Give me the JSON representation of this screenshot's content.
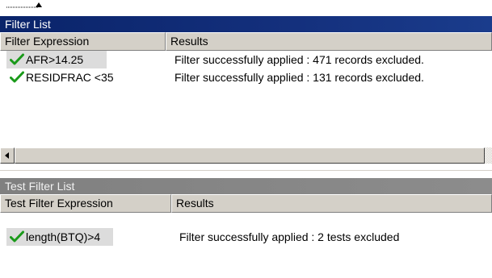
{
  "colors": {
    "title_active": "#0a246a",
    "title_inactive": "#808080",
    "check": "#1a9a1a",
    "selected_row": "#dcdcdc"
  },
  "filter_list": {
    "title": "Filter List",
    "columns": [
      "Filter Expression",
      "Results"
    ],
    "rows": [
      {
        "expression": "AFR>14.25",
        "result": "Filter successfully applied : 471 records excluded.",
        "icon": "green-check-icon"
      },
      {
        "expression": "RESIDFRAC <35",
        "result": "Filter successfully applied : 131 records excluded.",
        "icon": "green-check-icon"
      }
    ]
  },
  "test_filter_list": {
    "title": "Test Filter List",
    "columns": [
      "Test Filter Expression",
      "Results"
    ],
    "rows": [
      {
        "expression": "length(BTQ)>4",
        "result": "Filter successfully applied : 2 tests excluded",
        "icon": "green-check-icon"
      }
    ]
  }
}
